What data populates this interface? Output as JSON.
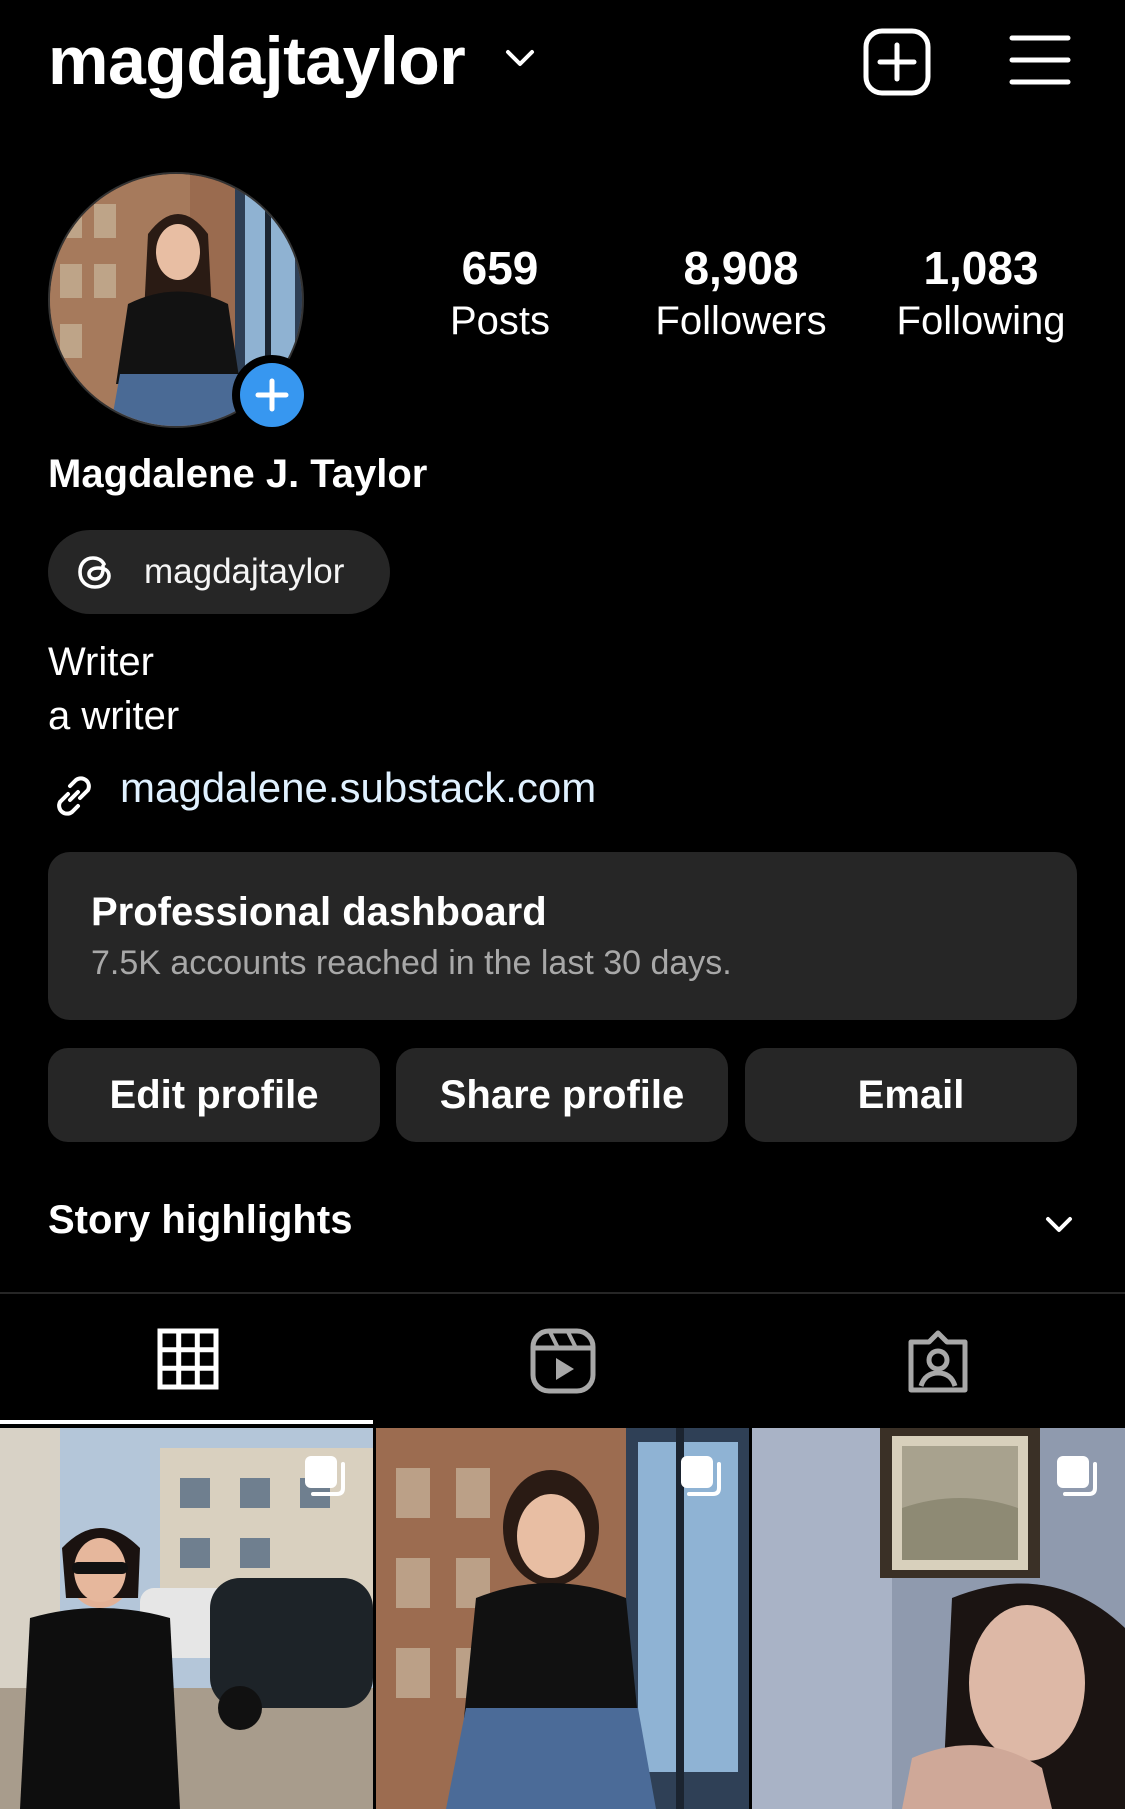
{
  "header": {
    "username": "magdajtaylor",
    "icons": [
      "chevron-down-icon",
      "new-post-icon",
      "menu-icon"
    ]
  },
  "profile": {
    "avatar_alt": "profile photo",
    "stats": [
      {
        "value": "659",
        "label": "Posts"
      },
      {
        "value": "8,908",
        "label": "Followers"
      },
      {
        "value": "1,083",
        "label": "Following"
      }
    ],
    "full_name": "Magdalene J. Taylor",
    "threads_handle": "magdajtaylor",
    "bio_line1": "Writer",
    "bio_line2": "a writer",
    "link": "magdalene.substack.com"
  },
  "dashboard": {
    "title": "Professional dashboard",
    "subtitle": "7.5K accounts reached in the last 30 days."
  },
  "actions": {
    "edit": "Edit profile",
    "share": "Share profile",
    "email": "Email"
  },
  "highlights": {
    "title": "Story highlights"
  },
  "tabs": [
    "grid",
    "reels",
    "tagged"
  ],
  "colors": {
    "background": "#000000",
    "surface": "#262626",
    "accent": "#3797f0",
    "secondary_text": "#a8a8a8"
  }
}
